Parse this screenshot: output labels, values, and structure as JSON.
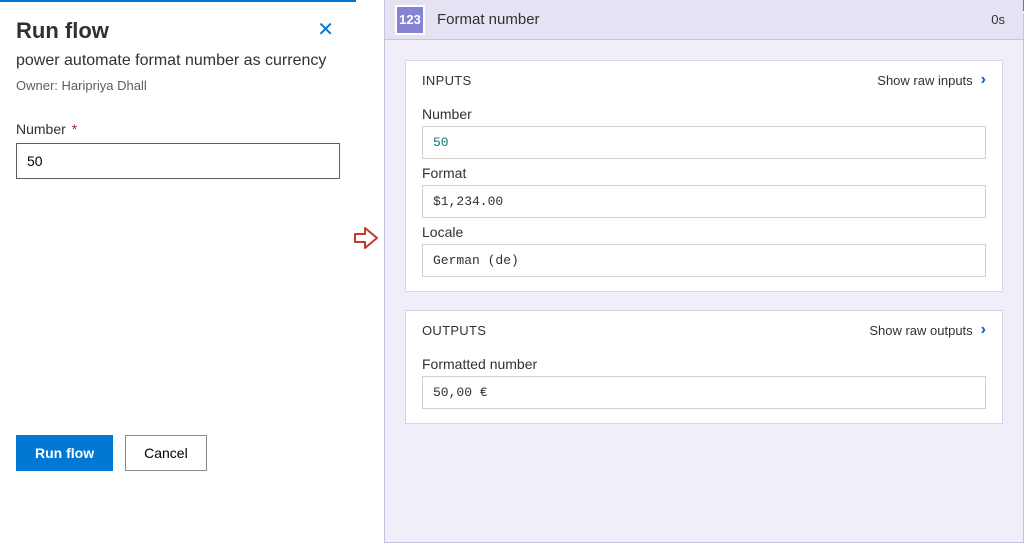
{
  "left": {
    "title": "Run flow",
    "flowName": "power automate format number as currency",
    "ownerLabel": "Owner: Haripriya Dhall",
    "numberLabel": "Number",
    "required": "*",
    "numberValue": "50",
    "runBtn": "Run flow",
    "cancelBtn": "Cancel"
  },
  "action": {
    "iconText": "123",
    "title": "Format number",
    "duration": "0s"
  },
  "inputs": {
    "heading": "INPUTS",
    "rawLink": "Show raw inputs",
    "fields": {
      "number": {
        "label": "Number",
        "value": "50"
      },
      "format": {
        "label": "Format",
        "value": "$1,234.00"
      },
      "locale": {
        "label": "Locale",
        "value": "German (de)"
      }
    }
  },
  "outputs": {
    "heading": "OUTPUTS",
    "rawLink": "Show raw outputs",
    "fields": {
      "formatted": {
        "label": "Formatted number",
        "value": "50,00 €"
      }
    }
  }
}
